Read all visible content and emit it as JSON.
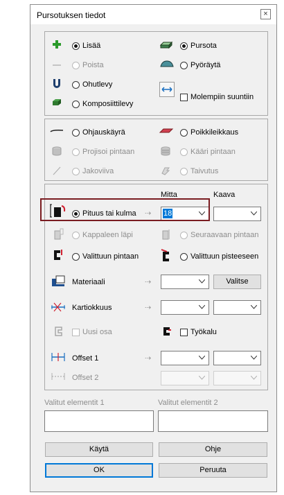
{
  "dialog": {
    "title": "Pursotuksen tiedot",
    "close_glyph": "×"
  },
  "mode": {
    "add": "Lisää",
    "remove": "Poista",
    "thin": "Ohutlevy",
    "composite": "Komposiittilevy",
    "extrude": "Pursota",
    "revolve": "Pyöräytä",
    "both_directions": "Molempiin suuntiin"
  },
  "path": {
    "guide_curve": "Ohjauskäyrä",
    "project_surface": "Projisoi pintaan",
    "split_curve": "Jakoviiva",
    "cross_section": "Poikkileikkaus",
    "wrap_surface": "Kääri pintaan",
    "bend": "Taivutus"
  },
  "extent": {
    "col_measure": "Mitta",
    "col_formula": "Kaava",
    "length_angle": "Pituus tai kulma",
    "length_value": "18",
    "through_part": "Kappaleen läpi",
    "next_face": "Seuraavaan pintaan",
    "selected_face": "Valittuun pintaan",
    "selected_point": "Valittuun pisteeseen",
    "material": "Materiaali",
    "select_button": "Valitse",
    "taper": "Kartiokkuus",
    "new_part": "Uusi osa",
    "tool": "Työkalu",
    "offset1": "Offset 1",
    "offset2": "Offset 2"
  },
  "selection": {
    "elements1": "Valitut elementit 1",
    "elements2": "Valitut elementit 2"
  },
  "buttons": {
    "apply": "Käytä",
    "help": "Ohje",
    "ok": "OK",
    "cancel": "Peruuta"
  },
  "colors": {
    "highlight": "#7a1c21",
    "focus": "#0078d7"
  }
}
